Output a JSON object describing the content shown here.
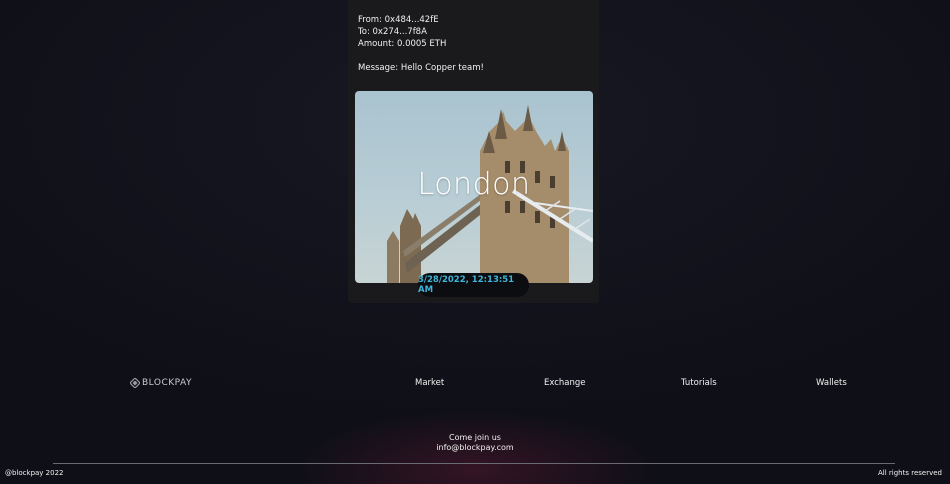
{
  "transaction": {
    "from": "From: 0x484...42fE",
    "to": "To: 0x274...7f8A",
    "amount": "Amount: 0.0005 ETH",
    "message": "Message: Hello Copper team!",
    "city": "London",
    "timestamp": "3/28/2022, 12:13:51 AM",
    "accent_color": "#3fb5d8"
  },
  "footer": {
    "logo_text": "BLOCKPAY",
    "nav": [
      "Market",
      "Exchange",
      "Tutorials",
      "Wallets"
    ],
    "join_label": "Come join us",
    "email": "info@blockpay.com",
    "copyright": "@blockpay 2022",
    "rights": "All rights reserved"
  }
}
